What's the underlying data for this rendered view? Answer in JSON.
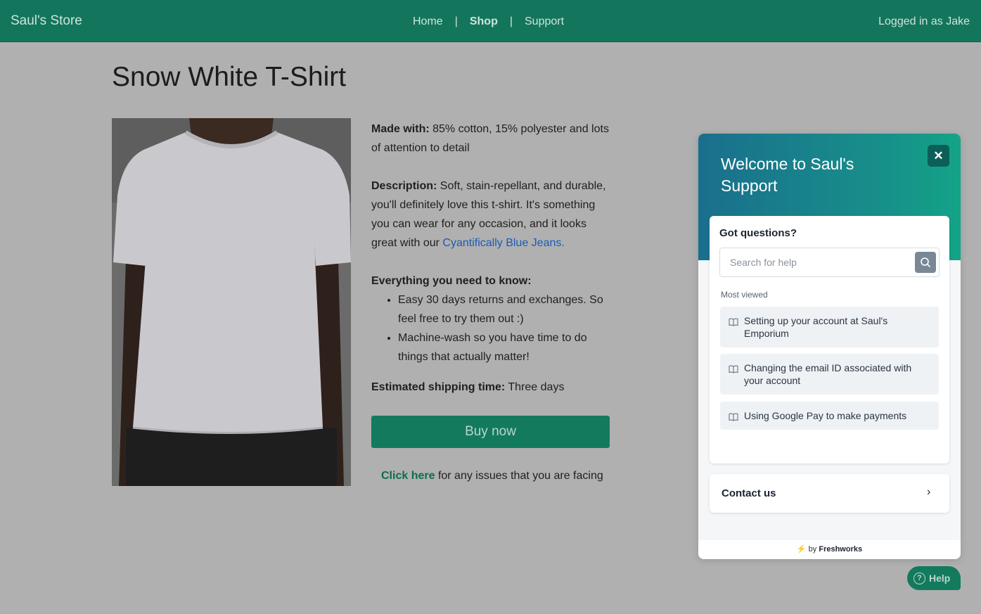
{
  "nav": {
    "brand": "Saul's Store",
    "links": [
      "Home",
      "Shop",
      "Support"
    ],
    "separator": "|",
    "login": "Logged in as Jake"
  },
  "product": {
    "title": "Snow White T-Shirt",
    "made_label": "Made with:",
    "made_text": "85% cotton, 15% polyester and lots of attention to detail",
    "desc_label": "Description:",
    "desc_text": "Soft, stain-repellant, and durable, you'll definitely love this t-shirt. It's something you can wear for any occasion, and it looks great with our",
    "desc_link": "Cyantifically Blue Jeans.",
    "know_label": "Everything you need to know:",
    "know_items": [
      "Easy 30 days returns and exchanges. So feel free to try them out :)",
      "Machine-wash so you have time to do things that actually matter!"
    ],
    "ship_label": "Estimated shipping time:",
    "ship_text": "Three days",
    "buy_label": "Buy now",
    "click_link": "Click here",
    "click_text": "for any issues that you are facing"
  },
  "widget": {
    "title": "Welcome to Saul's Support",
    "close_icon": "close-icon",
    "questions_title": "Got questions?",
    "search_placeholder": "Search for help",
    "most_viewed": "Most viewed",
    "articles": [
      "Setting up your account at Saul's Emporium",
      "Changing the email ID associated with your account",
      "Using Google Pay to make payments"
    ],
    "contact_label": "Contact us",
    "footer_by": "by",
    "footer_brand": "Freshworks"
  },
  "help_button": "Help",
  "colors": {
    "brand_green": "#13765c",
    "overlay_gray": "#b0b0b0",
    "link_blue": "#1a5bb5"
  }
}
